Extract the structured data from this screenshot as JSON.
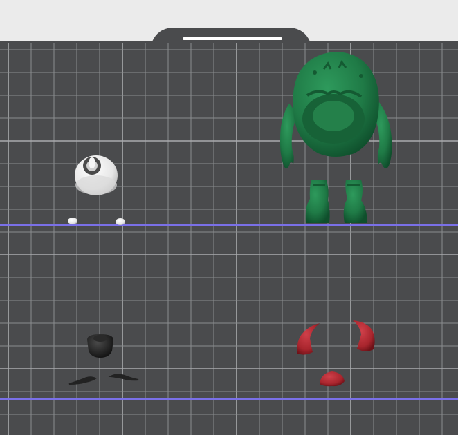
{
  "scene": {
    "background": "#ebebeb",
    "plate_color": "#4a4b4d",
    "grid_minor_color": "#8a8c8f",
    "grid_major_color": "#a9abae",
    "boundary_line_color": "#7a70e8",
    "handle_color": "#3b3c3e",
    "handle_highlight": "#ffffff"
  },
  "objects": {
    "green_monster": {
      "color": "#1f7a46",
      "parts": [
        "body",
        "left-arm",
        "right-arm",
        "left-foot",
        "right-foot"
      ]
    },
    "eye": {
      "color": "#f2f2f2",
      "pupil_color": "#4a4a4a"
    },
    "eye_pins": {
      "color": "#e0e0e0",
      "count": 2
    },
    "black_nub": {
      "color": "#1c1c1c"
    },
    "eyebrows": {
      "color": "#222222",
      "count": 2
    },
    "horns": {
      "color": "#a8252d",
      "count": 2
    },
    "red_cap": {
      "color": "#a8252d"
    }
  }
}
